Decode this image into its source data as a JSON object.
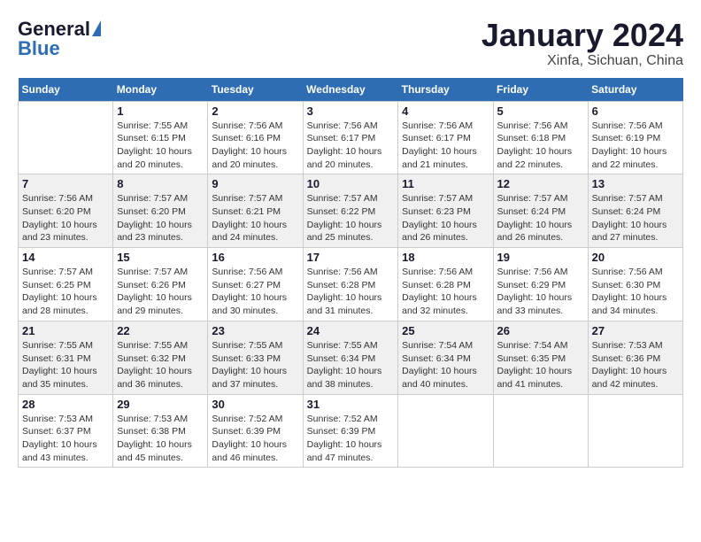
{
  "header": {
    "logo_general": "General",
    "logo_blue": "Blue",
    "month_title": "January 2024",
    "location": "Xinfa, Sichuan, China"
  },
  "days_of_week": [
    "Sunday",
    "Monday",
    "Tuesday",
    "Wednesday",
    "Thursday",
    "Friday",
    "Saturday"
  ],
  "weeks": [
    [
      {
        "day": "",
        "info": ""
      },
      {
        "day": "1",
        "info": "Sunrise: 7:55 AM\nSunset: 6:15 PM\nDaylight: 10 hours\nand 20 minutes."
      },
      {
        "day": "2",
        "info": "Sunrise: 7:56 AM\nSunset: 6:16 PM\nDaylight: 10 hours\nand 20 minutes."
      },
      {
        "day": "3",
        "info": "Sunrise: 7:56 AM\nSunset: 6:17 PM\nDaylight: 10 hours\nand 20 minutes."
      },
      {
        "day": "4",
        "info": "Sunrise: 7:56 AM\nSunset: 6:17 PM\nDaylight: 10 hours\nand 21 minutes."
      },
      {
        "day": "5",
        "info": "Sunrise: 7:56 AM\nSunset: 6:18 PM\nDaylight: 10 hours\nand 22 minutes."
      },
      {
        "day": "6",
        "info": "Sunrise: 7:56 AM\nSunset: 6:19 PM\nDaylight: 10 hours\nand 22 minutes."
      }
    ],
    [
      {
        "day": "7",
        "info": "Sunrise: 7:56 AM\nSunset: 6:20 PM\nDaylight: 10 hours\nand 23 minutes."
      },
      {
        "day": "8",
        "info": "Sunrise: 7:57 AM\nSunset: 6:20 PM\nDaylight: 10 hours\nand 23 minutes."
      },
      {
        "day": "9",
        "info": "Sunrise: 7:57 AM\nSunset: 6:21 PM\nDaylight: 10 hours\nand 24 minutes."
      },
      {
        "day": "10",
        "info": "Sunrise: 7:57 AM\nSunset: 6:22 PM\nDaylight: 10 hours\nand 25 minutes."
      },
      {
        "day": "11",
        "info": "Sunrise: 7:57 AM\nSunset: 6:23 PM\nDaylight: 10 hours\nand 26 minutes."
      },
      {
        "day": "12",
        "info": "Sunrise: 7:57 AM\nSunset: 6:24 PM\nDaylight: 10 hours\nand 26 minutes."
      },
      {
        "day": "13",
        "info": "Sunrise: 7:57 AM\nSunset: 6:24 PM\nDaylight: 10 hours\nand 27 minutes."
      }
    ],
    [
      {
        "day": "14",
        "info": "Sunrise: 7:57 AM\nSunset: 6:25 PM\nDaylight: 10 hours\nand 28 minutes."
      },
      {
        "day": "15",
        "info": "Sunrise: 7:57 AM\nSunset: 6:26 PM\nDaylight: 10 hours\nand 29 minutes."
      },
      {
        "day": "16",
        "info": "Sunrise: 7:56 AM\nSunset: 6:27 PM\nDaylight: 10 hours\nand 30 minutes."
      },
      {
        "day": "17",
        "info": "Sunrise: 7:56 AM\nSunset: 6:28 PM\nDaylight: 10 hours\nand 31 minutes."
      },
      {
        "day": "18",
        "info": "Sunrise: 7:56 AM\nSunset: 6:28 PM\nDaylight: 10 hours\nand 32 minutes."
      },
      {
        "day": "19",
        "info": "Sunrise: 7:56 AM\nSunset: 6:29 PM\nDaylight: 10 hours\nand 33 minutes."
      },
      {
        "day": "20",
        "info": "Sunrise: 7:56 AM\nSunset: 6:30 PM\nDaylight: 10 hours\nand 34 minutes."
      }
    ],
    [
      {
        "day": "21",
        "info": "Sunrise: 7:55 AM\nSunset: 6:31 PM\nDaylight: 10 hours\nand 35 minutes."
      },
      {
        "day": "22",
        "info": "Sunrise: 7:55 AM\nSunset: 6:32 PM\nDaylight: 10 hours\nand 36 minutes."
      },
      {
        "day": "23",
        "info": "Sunrise: 7:55 AM\nSunset: 6:33 PM\nDaylight: 10 hours\nand 37 minutes."
      },
      {
        "day": "24",
        "info": "Sunrise: 7:55 AM\nSunset: 6:34 PM\nDaylight: 10 hours\nand 38 minutes."
      },
      {
        "day": "25",
        "info": "Sunrise: 7:54 AM\nSunset: 6:34 PM\nDaylight: 10 hours\nand 40 minutes."
      },
      {
        "day": "26",
        "info": "Sunrise: 7:54 AM\nSunset: 6:35 PM\nDaylight: 10 hours\nand 41 minutes."
      },
      {
        "day": "27",
        "info": "Sunrise: 7:53 AM\nSunset: 6:36 PM\nDaylight: 10 hours\nand 42 minutes."
      }
    ],
    [
      {
        "day": "28",
        "info": "Sunrise: 7:53 AM\nSunset: 6:37 PM\nDaylight: 10 hours\nand 43 minutes."
      },
      {
        "day": "29",
        "info": "Sunrise: 7:53 AM\nSunset: 6:38 PM\nDaylight: 10 hours\nand 45 minutes."
      },
      {
        "day": "30",
        "info": "Sunrise: 7:52 AM\nSunset: 6:39 PM\nDaylight: 10 hours\nand 46 minutes."
      },
      {
        "day": "31",
        "info": "Sunrise: 7:52 AM\nSunset: 6:39 PM\nDaylight: 10 hours\nand 47 minutes."
      },
      {
        "day": "",
        "info": ""
      },
      {
        "day": "",
        "info": ""
      },
      {
        "day": "",
        "info": ""
      }
    ]
  ]
}
